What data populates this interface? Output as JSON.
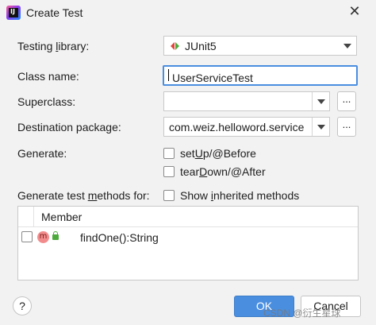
{
  "window": {
    "title": "Create Test",
    "close_glyph": "✕",
    "app_icon_text": "IJ"
  },
  "testing_library": {
    "label_pre": "Testing ",
    "label_u": "l",
    "label_post": "ibrary:",
    "value": "JUnit5",
    "icon": "junit-icon",
    "icon_colors": [
      "#e0463b",
      "#4caa3c"
    ]
  },
  "class_name": {
    "label": "Class name:",
    "value": "UserServiceTest"
  },
  "superclass": {
    "label": "Superclass:",
    "value": "",
    "browse_label": "..."
  },
  "destination": {
    "label": "Destination package:",
    "value": "com.weiz.helloword.service",
    "browse_label": "..."
  },
  "generate": {
    "label": "Generate:",
    "setup": {
      "pre": "set",
      "u": "U",
      "post": "p/@Before",
      "checked": false
    },
    "teardown": {
      "pre": "tear",
      "u": "D",
      "post": "own/@After",
      "checked": false
    }
  },
  "methods": {
    "label_pre": "Generate test ",
    "label_u": "m",
    "label_post": "ethods for:",
    "inherited": {
      "pre": "Show ",
      "u": "i",
      "post": "nherited methods",
      "checked": false
    }
  },
  "members_table": {
    "column_header": "Member",
    "rows": [
      {
        "icon": "method-icon",
        "icon_letter": "m",
        "access_icon": "lock-icon",
        "label": "findOne():String",
        "checked": false
      }
    ]
  },
  "buttons": {
    "help": "?",
    "ok": "OK",
    "cancel": "Cancel"
  },
  "watermark": "CSDN @衍生星球",
  "colors": {
    "accent": "#4a8ee0",
    "background": "#f2f2f2"
  }
}
